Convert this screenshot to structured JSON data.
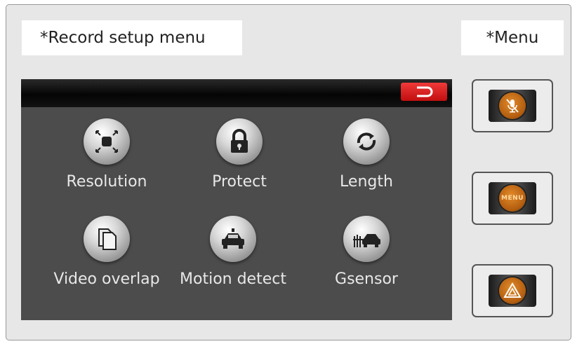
{
  "header": {
    "title": "*Record setup menu",
    "menu_label": "*Menu"
  },
  "screen": {
    "back_icon": "return-arrow-icon",
    "items": [
      {
        "label": "Resolution",
        "icon": "resolution-icon"
      },
      {
        "label": "Protect",
        "icon": "lock-icon"
      },
      {
        "label": "Length",
        "icon": "loop-icon"
      },
      {
        "label": "Video overlap",
        "icon": "overlap-icon"
      },
      {
        "label": "Motion detect",
        "icon": "car-icon"
      },
      {
        "label": "Gsensor",
        "icon": "crash-icon"
      }
    ]
  },
  "side_buttons": [
    {
      "icon": "mute-mic-icon"
    },
    {
      "icon": "menu-icon",
      "text": "MENU"
    },
    {
      "icon": "warning-icon"
    }
  ],
  "colors": {
    "accent": "#d1771c",
    "back_button": "#e02a2a",
    "screen_bg": "#4c4c4c"
  }
}
